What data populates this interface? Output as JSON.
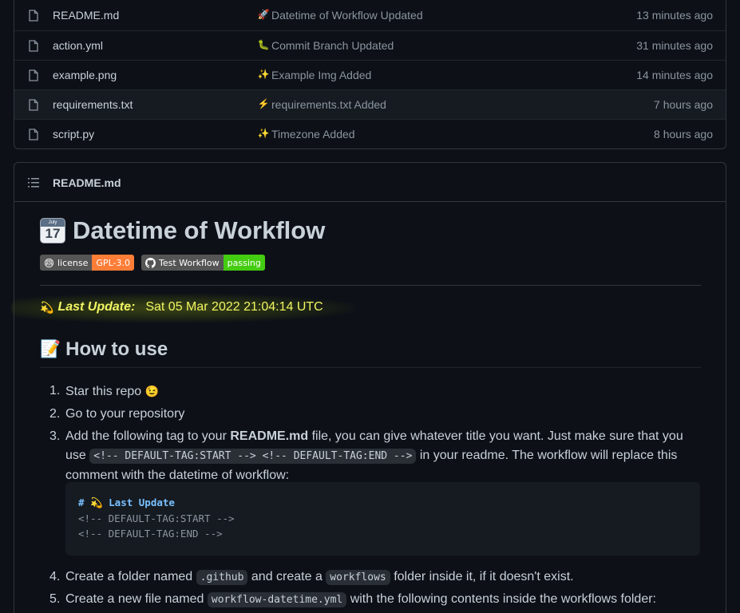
{
  "files": [
    {
      "name": "README.md",
      "emoji": "🚀",
      "commit": "Datetime of Workflow Updated",
      "time": "13 minutes ago"
    },
    {
      "name": "action.yml",
      "emoji": "🐛",
      "commit": "Commit Branch Updated",
      "time": "31 minutes ago"
    },
    {
      "name": "example.png",
      "emoji": "✨",
      "commit": "Example Img Added",
      "time": "14 minutes ago"
    },
    {
      "name": "requirements.txt",
      "emoji": "⚡",
      "commit": "requirements.txt Added",
      "time": "7 hours ago"
    },
    {
      "name": "script.py",
      "emoji": "✨",
      "commit": "Timezone Added",
      "time": "8 hours ago"
    }
  ],
  "readme": {
    "header_title": "README.md",
    "title_icon": {
      "month": "July",
      "day": "17"
    },
    "title": "Datetime of Workflow",
    "badges": [
      {
        "label": "license",
        "value": "GPL-3.0",
        "color": "#fe7d37",
        "icon": "license-icon"
      },
      {
        "label": "Test Workflow",
        "value": "passing",
        "color": "#4c1",
        "icon": "github-icon"
      }
    ],
    "last_update": {
      "icon": "💫",
      "label": "Last Update:",
      "value": "Sat 05 Mar 2022 21:04:14 UTC"
    },
    "how_to": {
      "icon": "📝",
      "title": "How to use"
    },
    "steps": {
      "s1": {
        "num": "1.",
        "text": "Star this repo ",
        "emoji": "😉"
      },
      "s2": {
        "num": "2.",
        "text": "Go to your repository"
      },
      "s3": {
        "num": "3.",
        "pre": "Add the following tag to your ",
        "bold": "README.md",
        "mid": " file, you can give whatever title you want. Just make sure that you use ",
        "code": "<!-- DEFAULT-TAG:START --> <!-- DEFAULT-TAG:END -->",
        "post": " in your readme. The workflow will replace this comment with the datetime of workflow:"
      },
      "s4": {
        "num": "4.",
        "pre": "Create a folder named ",
        "code1": ".github",
        "mid": " and create a ",
        "code2": "workflows",
        "post": " folder inside it, if it doesn't exist."
      },
      "s5": {
        "num": "5.",
        "pre": "Create a new file named ",
        "code": "workflow-datetime.yml",
        "post": " with the following contents inside the workflows folder:"
      }
    },
    "codeblock": {
      "line1": "# 💫 Last Update",
      "line2": "<!-- DEFAULT-TAG:START -->",
      "line3": "<!-- DEFAULT-TAG:END -->"
    }
  }
}
